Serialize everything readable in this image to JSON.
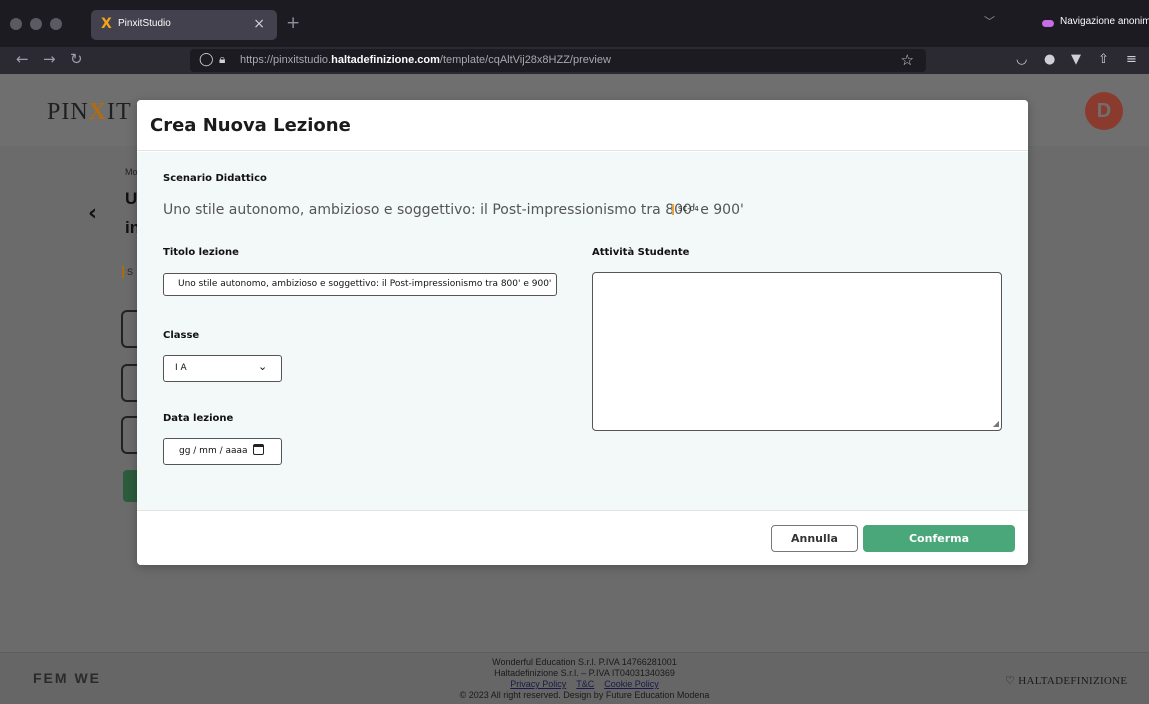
{
  "browser": {
    "tab_title": "PinxitStudio",
    "tab_logo": "X",
    "tab_close": "×",
    "new_tab": "+",
    "private_label": "Navigazione anonima",
    "url_prefix": "https://pinxitstudio.",
    "url_domain": "haltadefinizione.com",
    "url_path": "/template/cqAltVij28x8HZZ/preview",
    "nav_icons": [
      "back-arrow-icon",
      "forward-arrow-icon",
      "reload-icon"
    ],
    "right_icons": [
      "pocket-icon",
      "extension-icon",
      "vpn-icon",
      "share-icon",
      "menu-icon"
    ]
  },
  "page": {
    "logo_left": "PIN",
    "logo_mid": "X",
    "logo_right": "IT",
    "avatar_initial": "D",
    "bg_texts": [
      "Mo",
      "U",
      "in",
      "S"
    ]
  },
  "modal": {
    "title": "Crea Nuova Lezione",
    "scenario_label": "Scenario Didattico",
    "scenario_text": "Uno stile autonomo, ambizioso e soggettivo: il Post-impressionismo tra 800' e 900'",
    "scenario_code": "SC-04",
    "titolo_label": "Titolo lezione",
    "titolo_value": "Uno stile autonomo, ambizioso e soggettivo: il Post-impressionismo tra 800' e 900'",
    "classe_label": "Classe",
    "classe_value": "I A",
    "data_label": "Data lezione",
    "data_placeholder": "gg / mm / aaaa",
    "attivita_label": "Attività Studente",
    "attivita_value": "",
    "cancel_label": "Annulla",
    "confirm_label": "Conferma",
    "confirm_color": "#4aa77a"
  },
  "footer": {
    "left_brand": "FEM WE",
    "line1": "Wonderful Education S.r.l. P.IVA 14766281001",
    "line2": "Haltadefinizione S.r.l. – P.IVA IT04031340369",
    "links": [
      "Privacy Policy",
      "T&C",
      "Cookie Policy"
    ],
    "line4": "© 2023 All right reserved. Design by Future Education Modena",
    "right_brand": "HALTADEFINIZIONE"
  }
}
